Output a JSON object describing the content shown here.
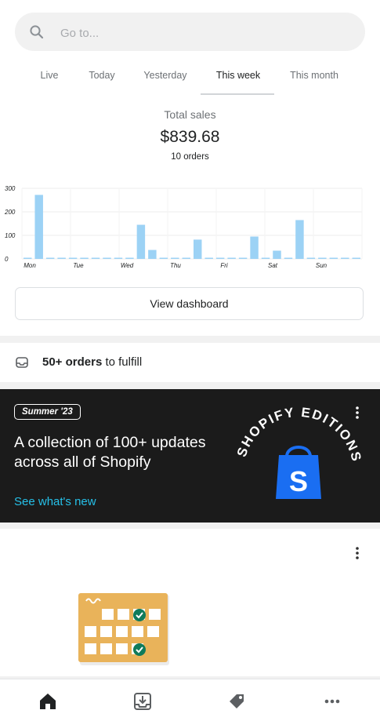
{
  "search": {
    "placeholder": "Go to..."
  },
  "tabs": [
    {
      "label": "Live"
    },
    {
      "label": "Today"
    },
    {
      "label": "Yesterday"
    },
    {
      "label": "This week",
      "active": true
    },
    {
      "label": "This month"
    }
  ],
  "summary": {
    "label": "Total sales",
    "amount": "$839.68",
    "orders": "10 orders"
  },
  "chart_data": {
    "type": "bar",
    "y_ticks": [
      "300",
      "200",
      "100",
      "0"
    ],
    "ylim": [
      0,
      300
    ],
    "x_tick_labels": [
      "Mon",
      "Tue",
      "Wed",
      "Thu",
      "Fri",
      "Sat",
      "Sun"
    ],
    "values": [
      5,
      272,
      5,
      5,
      5,
      5,
      5,
      5,
      5,
      5,
      145,
      38,
      5,
      5,
      5,
      82,
      5,
      5,
      5,
      5,
      95,
      5,
      35,
      5,
      165,
      5,
      5,
      5,
      5,
      5
    ],
    "bar_color": "#9cd2f5",
    "grid": true
  },
  "dashboard_button": {
    "label": "View dashboard"
  },
  "fulfill": {
    "count": "50+ orders",
    "suffix": " to fulfill"
  },
  "promo": {
    "badge": "Summer '23",
    "headline": "A collection of 100+ updates across all of Shopify",
    "link": "See what's new",
    "ring_text": "SHOPIFY EDITIONS ",
    "bag_letter": "S"
  },
  "bottom_nav": [
    {
      "name": "home",
      "icon": "home-icon",
      "active": true
    },
    {
      "name": "orders",
      "icon": "inbox-download-icon"
    },
    {
      "name": "products",
      "icon": "tag-icon"
    },
    {
      "name": "more",
      "icon": "more-horizontal-icon"
    }
  ],
  "colors": {
    "accent_link": "#26c0e8",
    "promo_bg": "#1b1b1b",
    "bar": "#9cd2f5",
    "shopify_bag": "#1a6ef2",
    "calendar": "#e9b35a",
    "check": "#0f7b5b"
  }
}
